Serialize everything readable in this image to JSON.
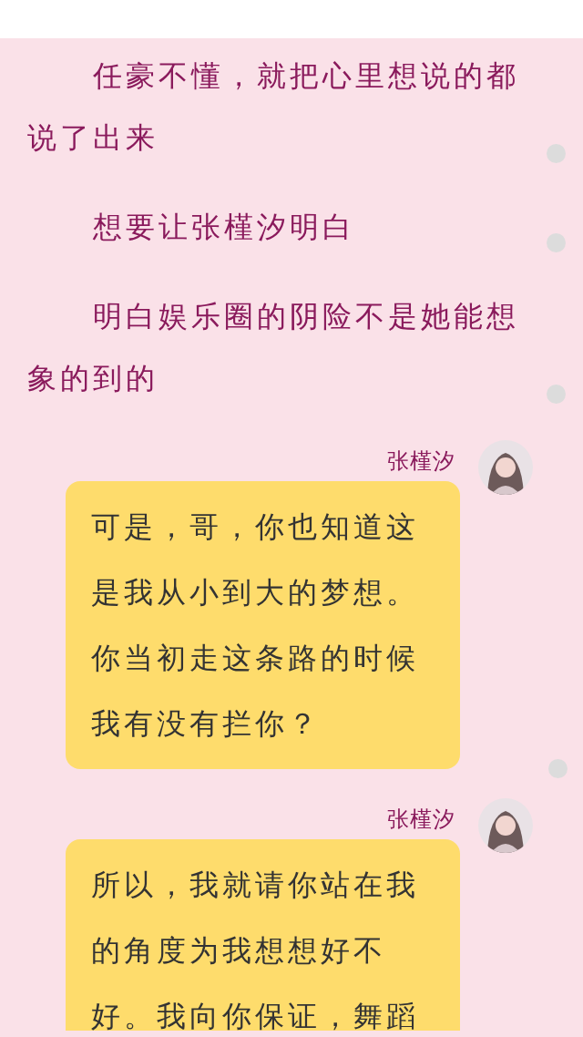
{
  "blocks": [
    {
      "kind": "paragraph",
      "text": "任豪不懂，就把心里想说的都说了出来",
      "comment_marker": true
    },
    {
      "kind": "paragraph",
      "text": "想要让张槿汐明白",
      "comment_marker": true
    },
    {
      "kind": "paragraph",
      "text": "明白娱乐圈的阴险不是她能想象的到的",
      "comment_marker": true
    },
    {
      "kind": "message",
      "sender": "张槿汐",
      "text": "可是，哥，你也知道这是我从小到大的梦想。你当初走这条路的时候我有没有拦你？",
      "comment_marker": true
    },
    {
      "kind": "message",
      "sender": "张槿汐",
      "text": "所以，我就请你站在我的角度为我想想好不好。我向你保证，舞蹈"
    }
  ]
}
